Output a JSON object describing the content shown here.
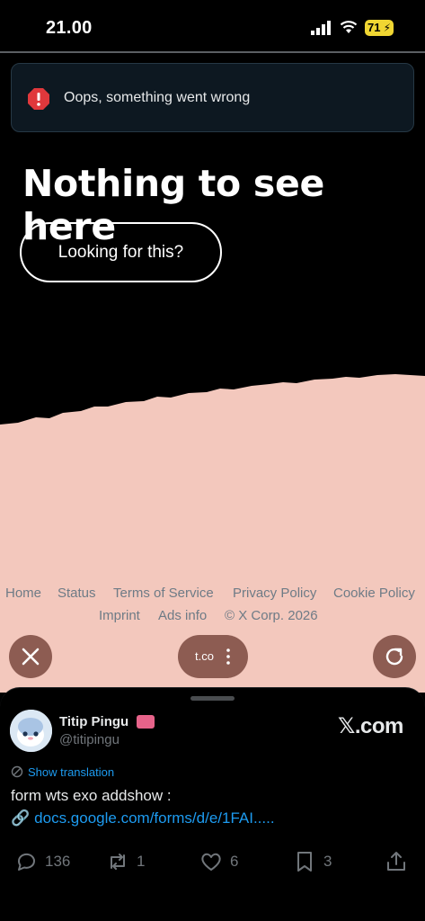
{
  "status_bar": {
    "time": "21.00",
    "battery": "71"
  },
  "error": {
    "message": "Oops, something went wrong"
  },
  "main": {
    "title": "Nothing to see here",
    "button_label": "Looking for this?"
  },
  "footer": {
    "links": [
      "Home",
      "Status",
      "Terms of Service",
      "Privacy Policy",
      "Cookie Policy",
      "Imprint",
      "Ads info",
      "© X Corp. 2026"
    ]
  },
  "browser_controls": {
    "url": "t.co"
  },
  "tweet": {
    "display_name": "Titip Pingu",
    "handle": "@titipingu",
    "brand": "𝕏.com",
    "show_translation": "Show translation",
    "text": "form wts exo addshow :",
    "link": "docs.google.com/forms/d/e/1FAI.....",
    "link_icon": "🔗",
    "replies": "136",
    "reposts": "1",
    "likes": "6",
    "bookmarks": "3"
  },
  "colors": {
    "background": "#000000",
    "pink": "#f3c8bd",
    "accent": "#1d9bf0",
    "error_red": "#e0383c",
    "fab": "#8d5c52"
  }
}
